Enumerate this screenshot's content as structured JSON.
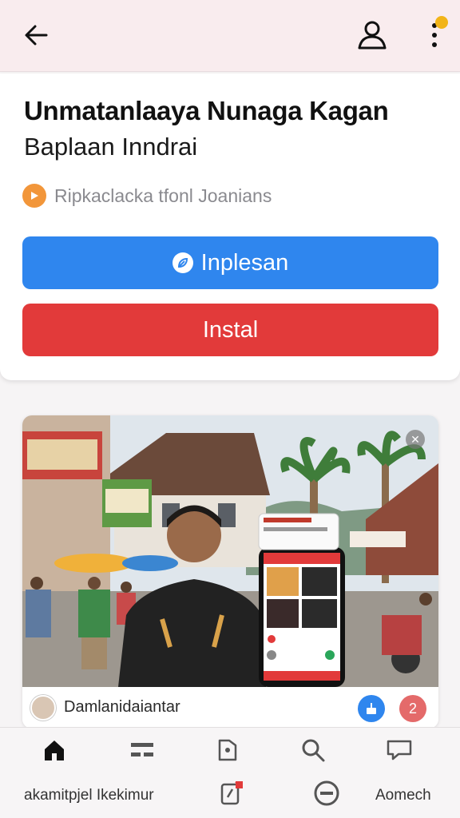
{
  "header": {
    "back_icon": "arrow-left-icon",
    "profile_icon": "person-icon",
    "more_icon": "more-vertical-icon",
    "notification_dot_color": "#f2b418"
  },
  "app": {
    "title": "Unmatanlaaya Nunaga Kagan",
    "subtitle": "Baplaan Inndrai",
    "developer": "Ripkaclacka tfonl Joanians",
    "developer_icon": "play-icon"
  },
  "buttons": {
    "primary_label": "Inplesan",
    "primary_color": "#2f86ee",
    "install_label": "Instal",
    "install_color": "#e23a3a"
  },
  "media": {
    "caption": "Damlanidaiantar",
    "badge_count": "2",
    "share_icon": "share-icon",
    "close_icon": "close-icon"
  },
  "bottom_nav": {
    "items_icons": [
      "home-icon",
      "list-icon",
      "tag-icon",
      "search-icon",
      "chat-icon"
    ],
    "label_left": "akamitpjel Ikekimur",
    "center_icon_1": "edit-icon",
    "center_icon_2": "minus-circle-icon",
    "label_right": "Aomech"
  }
}
